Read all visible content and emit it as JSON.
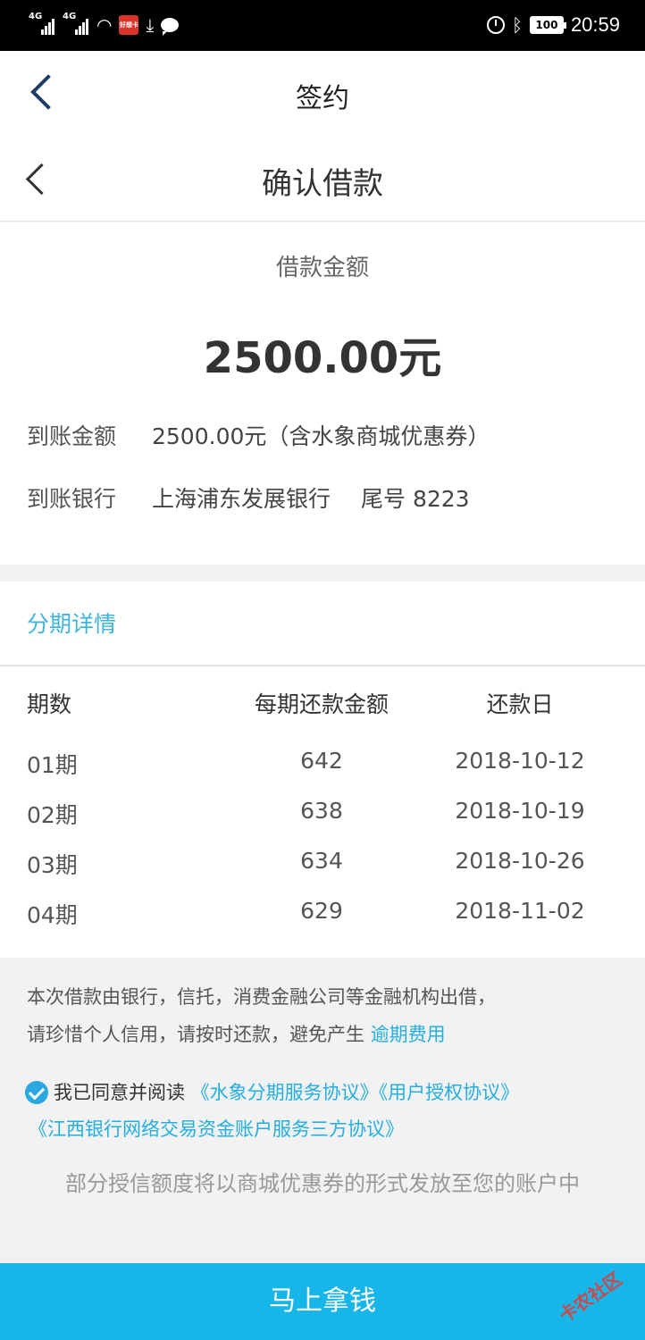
{
  "status_bar": {
    "sim1": "4G",
    "sim2": "4G",
    "app_badge": "好想卡",
    "battery": "100",
    "time": "20:59"
  },
  "outer_header": {
    "title": "签约"
  },
  "inner_header": {
    "title": "确认借款"
  },
  "loan": {
    "amount_label": "借款金额",
    "amount": "2500.00元",
    "received_label": "到账金额",
    "received_value": "2500.00元（含水象商城优惠券）",
    "bank_label": "到账银行",
    "bank_name": "上海浦东发展银行",
    "bank_tail": "尾号 8223"
  },
  "installments": {
    "title": "分期详情",
    "headers": [
      "期数",
      "每期还款金额",
      "还款日"
    ],
    "rows": [
      [
        "01期",
        "642",
        "2018-10-12"
      ],
      [
        "02期",
        "638",
        "2018-10-19"
      ],
      [
        "03期",
        "634",
        "2018-10-26"
      ],
      [
        "04期",
        "629",
        "2018-11-02"
      ]
    ]
  },
  "notice": {
    "line1": "本次借款由银行，信托，消费金融公司等金融机构出借，",
    "line2": "请珍惜个人信用，请按时还款，避免产生",
    "fee_link": "逾期费用"
  },
  "agreement": {
    "checked": true,
    "prefix": "我已同意并阅读",
    "link1": "《水象分期服务协议》",
    "link2": "《用户授权协议》",
    "link3": "《江西银行网络交易资金账户服务三方协议》"
  },
  "tip": "部分授信额度将以商城优惠券的形式发放至您的账户中",
  "cta": {
    "label": "马上拿钱"
  },
  "watermark": "卡农社区",
  "colors": {
    "accent": "#17b6e8",
    "link": "#24aee0",
    "section_title": "#3fb5d9"
  }
}
